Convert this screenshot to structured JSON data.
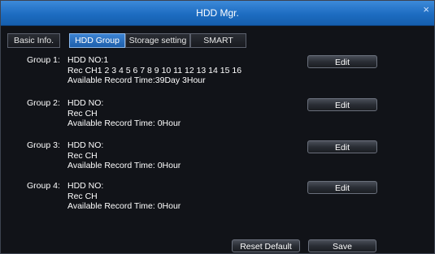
{
  "window": {
    "title": "HDD Mgr.",
    "close_glyph": "×"
  },
  "tabs": [
    {
      "label": "Basic Info.",
      "active": false
    },
    {
      "label": "HDD Group",
      "active": true
    },
    {
      "label": "Storage setting",
      "active": false
    },
    {
      "label": "SMART",
      "active": false
    }
  ],
  "groups": [
    {
      "label": "Group 1:",
      "hdd_no": "HDD NO:1",
      "rec_ch": "Rec CH1 2 3 4 5 6 7 8 9 10 11 12 13 14 15 16",
      "available": "Available Record Time:39Day 3Hour",
      "edit_label": "Edit"
    },
    {
      "label": "Group 2:",
      "hdd_no": "HDD NO:",
      "rec_ch": "Rec CH",
      "available": "Available Record Time: 0Hour",
      "edit_label": "Edit"
    },
    {
      "label": "Group 3:",
      "hdd_no": "HDD NO:",
      "rec_ch": "Rec CH",
      "available": "Available Record Time: 0Hour",
      "edit_label": "Edit"
    },
    {
      "label": "Group 4:",
      "hdd_no": "HDD NO:",
      "rec_ch": "Rec CH",
      "available": "Available Record Time: 0Hour",
      "edit_label": "Edit"
    }
  ],
  "footer": {
    "reset_label": "Reset Default",
    "save_label": "Save"
  },
  "colors": {
    "title_bar": "#1d6cc1",
    "active_tab": "#2f73c4",
    "background": "#111318"
  }
}
